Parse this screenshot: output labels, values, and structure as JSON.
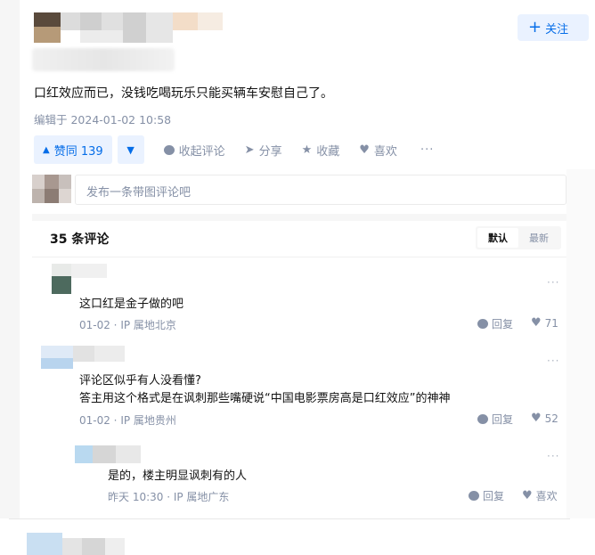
{
  "follow_label": "关注",
  "answer_text": "口红效应而已，没钱吃喝玩乐只能买辆车安慰自己了。",
  "edit_time": "编辑于 2024-01-02 10:58",
  "actions": {
    "upvote_label": "赞同 139",
    "collapse_comments": "收起评论",
    "share": "分享",
    "favorite": "收藏",
    "like": "喜欢",
    "more": "···"
  },
  "composer_placeholder": "发布一条带图评论吧",
  "comments_count": "35 条评论",
  "sort": {
    "default": "默认",
    "latest": "最新"
  },
  "comments": [
    {
      "text": "这口红是金子做的吧",
      "meta": "01-02 · IP 属地北京",
      "reply": "回复",
      "likes": "71",
      "more": "···"
    },
    {
      "text_line1": "评论区似乎有人没看懂?",
      "text_line2": "答主用这个格式是在讽刺那些嘴硬说“中国电影票房高是口红效应”的神神",
      "meta": "01-02 · IP 属地贵州",
      "reply": "回复",
      "likes": "52",
      "more": "···"
    },
    {
      "text": "是的，楼主明显讽刺有的人",
      "meta": "昨天 10:30 · IP 属地广东",
      "reply": "回复",
      "likes": "喜欢",
      "more": "···"
    }
  ],
  "colors": {
    "accent": "#056de8",
    "accent_bg": "#eaf2ff",
    "muted": "#8590a6",
    "text": "#121212"
  }
}
